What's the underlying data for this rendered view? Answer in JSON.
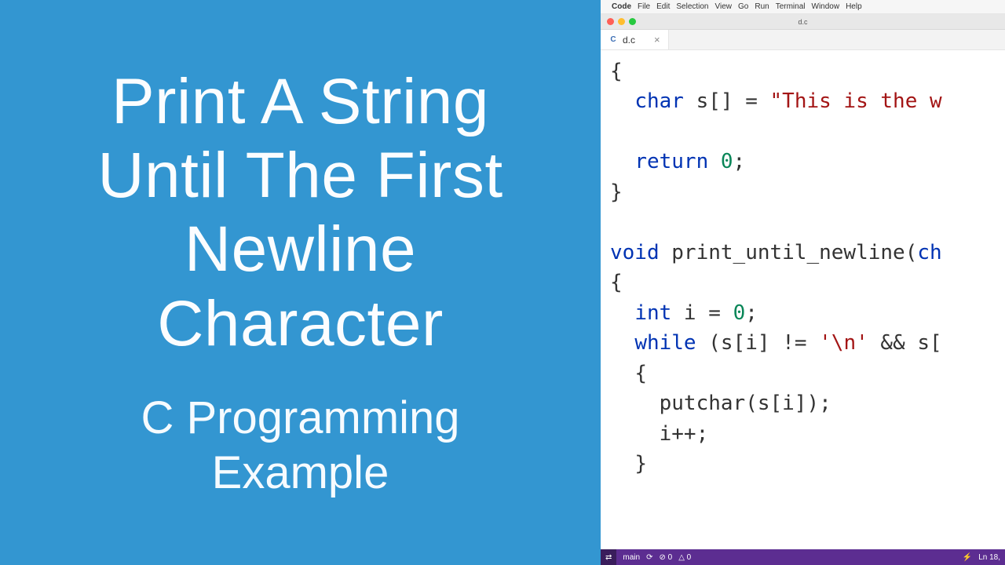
{
  "left": {
    "title_lines": [
      "Print A String",
      "Until The First",
      "Newline",
      "Character"
    ],
    "subtitle_lines": [
      "C Programming",
      "Example"
    ]
  },
  "menubar": {
    "apple": "",
    "app": "Code",
    "items": [
      "File",
      "Edit",
      "Selection",
      "View",
      "Go",
      "Run",
      "Terminal",
      "Window",
      "Help"
    ]
  },
  "window": {
    "title": "d.c"
  },
  "tab": {
    "icon": "C",
    "name": "d.c",
    "close": "×"
  },
  "code": {
    "lines": [
      {
        "indent": 0,
        "tokens": [
          {
            "t": "{",
            "c": "op"
          }
        ]
      },
      {
        "indent": 1,
        "tokens": [
          {
            "t": "char",
            "c": "type"
          },
          {
            "t": " s[] = ",
            "c": "op"
          },
          {
            "t": "\"This is the w",
            "c": "string"
          }
        ]
      },
      {
        "indent": 0,
        "tokens": []
      },
      {
        "indent": 1,
        "tokens": [
          {
            "t": "return",
            "c": "keyword"
          },
          {
            "t": " ",
            "c": "op"
          },
          {
            "t": "0",
            "c": "num"
          },
          {
            "t": ";",
            "c": "op"
          }
        ]
      },
      {
        "indent": 0,
        "tokens": [
          {
            "t": "}",
            "c": "op"
          }
        ]
      },
      {
        "indent": 0,
        "tokens": []
      },
      {
        "indent": 0,
        "tokens": [
          {
            "t": "void",
            "c": "type"
          },
          {
            "t": " print_until_newline(",
            "c": "fn"
          },
          {
            "t": "ch",
            "c": "type"
          }
        ]
      },
      {
        "indent": 0,
        "tokens": [
          {
            "t": "{",
            "c": "op"
          }
        ]
      },
      {
        "indent": 1,
        "tokens": [
          {
            "t": "int",
            "c": "type"
          },
          {
            "t": " i = ",
            "c": "op"
          },
          {
            "t": "0",
            "c": "num"
          },
          {
            "t": ";",
            "c": "op"
          }
        ]
      },
      {
        "indent": 1,
        "tokens": [
          {
            "t": "while",
            "c": "keyword"
          },
          {
            "t": " (s[i] != ",
            "c": "op"
          },
          {
            "t": "'\\n'",
            "c": "char"
          },
          {
            "t": " && s[",
            "c": "op"
          }
        ]
      },
      {
        "indent": 1,
        "tokens": [
          {
            "t": "{",
            "c": "op"
          }
        ]
      },
      {
        "indent": 2,
        "tokens": [
          {
            "t": "putchar(s[i]);",
            "c": "fn"
          }
        ]
      },
      {
        "indent": 2,
        "tokens": [
          {
            "t": "i++;",
            "c": "op"
          }
        ]
      },
      {
        "indent": 1,
        "tokens": [
          {
            "t": "}",
            "c": "op"
          }
        ]
      }
    ]
  },
  "status": {
    "remote": "⇄",
    "branch": "main",
    "sync": "⟳",
    "errors": "⊘ 0",
    "warnings": "△ 0",
    "port": "⚡",
    "position": "Ln 18,"
  }
}
